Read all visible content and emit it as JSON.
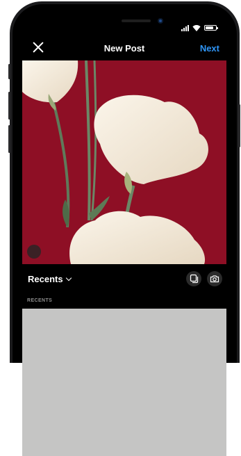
{
  "header": {
    "title": "New Post",
    "next_label": "Next"
  },
  "gallery": {
    "album_label": "Recents",
    "section_label": "RECENTS"
  },
  "icons": {
    "close": "close-icon",
    "expand": "expand-icon",
    "chevron": "chevron-down-icon",
    "multi_select": "multi-select-icon",
    "camera": "camera-icon"
  },
  "colors": {
    "accent": "#2f95f6",
    "photo_background": "#8e0f25",
    "placeholder_grid": "#c5c5c4"
  }
}
